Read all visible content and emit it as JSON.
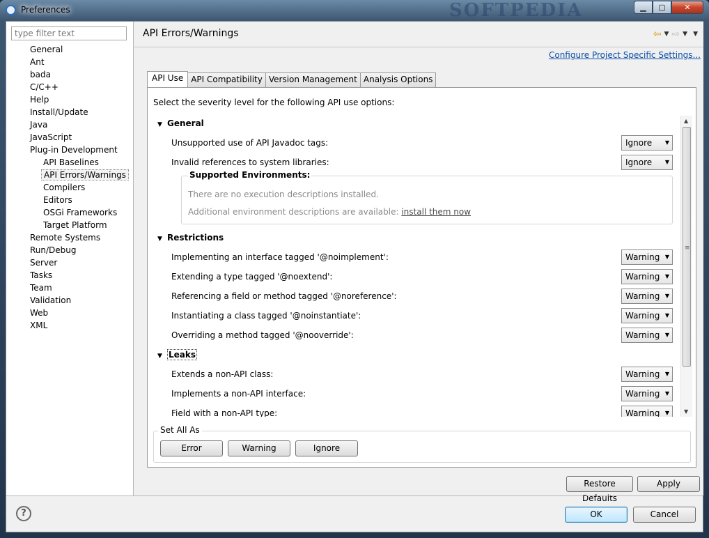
{
  "window": {
    "title": "Preferences",
    "watermark": "SOFTPEDIA",
    "buttons": {
      "minimize": "▁",
      "maximize": "▢",
      "close": "✕"
    }
  },
  "filter": {
    "placeholder": "type filter text",
    "value": ""
  },
  "tree": [
    {
      "label": "General",
      "level": 0
    },
    {
      "label": "Ant",
      "level": 0
    },
    {
      "label": "bada",
      "level": 0
    },
    {
      "label": "C/C++",
      "level": 0
    },
    {
      "label": "Help",
      "level": 0
    },
    {
      "label": "Install/Update",
      "level": 0
    },
    {
      "label": "Java",
      "level": 0
    },
    {
      "label": "JavaScript",
      "level": 0
    },
    {
      "label": "Plug-in Development",
      "level": 0
    },
    {
      "label": "API Baselines",
      "level": 1
    },
    {
      "label": "API Errors/Warnings",
      "level": 1,
      "selected": true
    },
    {
      "label": "Compilers",
      "level": 1
    },
    {
      "label": "Editors",
      "level": 1
    },
    {
      "label": "OSGi Frameworks",
      "level": 1
    },
    {
      "label": "Target Platform",
      "level": 1
    },
    {
      "label": "Remote Systems",
      "level": 0
    },
    {
      "label": "Run/Debug",
      "level": 0
    },
    {
      "label": "Server",
      "level": 0
    },
    {
      "label": "Tasks",
      "level": 0
    },
    {
      "label": "Team",
      "level": 0
    },
    {
      "label": "Validation",
      "level": 0
    },
    {
      "label": "Web",
      "level": 0
    },
    {
      "label": "XML",
      "level": 0
    }
  ],
  "page": {
    "title": "API Errors/Warnings",
    "configure_link": "Configure Project Specific Settings...",
    "tabs": [
      "API Use",
      "API Compatibility",
      "Version Management",
      "Analysis Options"
    ],
    "active_tab": "API Use",
    "intro": "Select the severity level for the following API use options:"
  },
  "sections": {
    "general": {
      "title": "General",
      "options": [
        {
          "label": "Unsupported use of API Javadoc tags:",
          "value": "Ignore"
        },
        {
          "label": "Invalid references to system libraries:",
          "value": "Ignore"
        }
      ],
      "env": {
        "title": "Supported Environments:",
        "none_text": "There are no execution descriptions installed.",
        "available_text": "Additional environment descriptions are available:",
        "install_link": "install them now"
      }
    },
    "restrictions": {
      "title": "Restrictions",
      "options": [
        {
          "label": "Implementing an interface tagged '@noimplement':",
          "value": "Warning"
        },
        {
          "label": "Extending a type tagged '@noextend':",
          "value": "Warning"
        },
        {
          "label": "Referencing a field or method tagged '@noreference':",
          "value": "Warning"
        },
        {
          "label": "Instantiating a class tagged '@noinstantiate':",
          "value": "Warning"
        },
        {
          "label": "Overriding a method tagged '@nooverride':",
          "value": "Warning"
        }
      ]
    },
    "leaks": {
      "title": "Leaks",
      "options": [
        {
          "label": "Extends a non-API class:",
          "value": "Warning"
        },
        {
          "label": "Implements a non-API interface:",
          "value": "Warning"
        },
        {
          "label": "Field with a non-API type:",
          "value": "Warning"
        }
      ]
    }
  },
  "set_all": {
    "title": "Set All As",
    "buttons": [
      "Error",
      "Warning",
      "Ignore"
    ]
  },
  "page_buttons": {
    "restore": "Restore Defaults",
    "apply": "Apply"
  },
  "dialog_buttons": {
    "ok": "OK",
    "cancel": "Cancel"
  },
  "icons": {
    "help": "?",
    "back": "⇦",
    "forward": "⇨",
    "dropdown": "▼",
    "expanded": "▼",
    "scroll_up": "▲",
    "scroll_down": "▼",
    "grip": "≡"
  }
}
